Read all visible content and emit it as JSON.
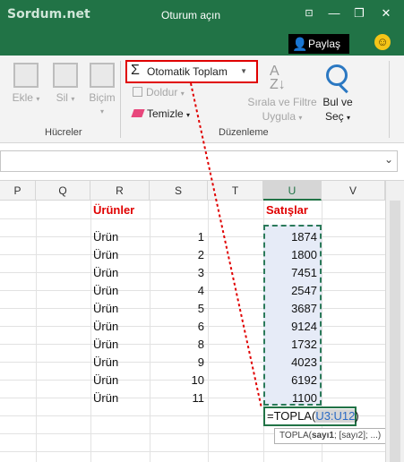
{
  "watermark": "Sordum.net",
  "window": {
    "title": "Oturum açın",
    "restore_ribbon_icon": "ribbon-display-icon",
    "minimize": "—",
    "maximize": "❐",
    "close": "✕"
  },
  "share": {
    "label": "Paylaş",
    "icon": "person-icon"
  },
  "ribbon": {
    "cells_group": {
      "label": "Hücreler",
      "insert": "Ekle",
      "delete": "Sil",
      "format": "Biçim"
    },
    "editing_group": {
      "label": "Düzenleme",
      "autosum": "Otomatik Toplam",
      "fill": "Doldur",
      "clear": "Temizle",
      "sort_filter_line1": "Sırala ve Filtre",
      "sort_filter_line2": "Uygula",
      "find_line1": "Bul ve",
      "find_line2": "Seç"
    }
  },
  "columns": [
    "P",
    "Q",
    "R",
    "S",
    "T",
    "U",
    "V"
  ],
  "selected_column": "U",
  "sheet": {
    "header_products": "Ürünler",
    "header_sales": "Satışlar",
    "rows": [
      {
        "product": "Ürün",
        "num": "1",
        "sales": "1874"
      },
      {
        "product": "Ürün",
        "num": "2",
        "sales": "1800"
      },
      {
        "product": "Ürün",
        "num": "3",
        "sales": "7451"
      },
      {
        "product": "Ürün",
        "num": "4",
        "sales": "2547"
      },
      {
        "product": "Ürün",
        "num": "5",
        "sales": "3687"
      },
      {
        "product": "Ürün",
        "num": "6",
        "sales": "9124"
      },
      {
        "product": "Ürün",
        "num": "8",
        "sales": "1732"
      },
      {
        "product": "Ürün",
        "num": "9",
        "sales": "4023"
      },
      {
        "product": "Ürün",
        "num": "10",
        "sales": "6192"
      },
      {
        "product": "Ürün",
        "num": "11",
        "sales": "1100"
      }
    ]
  },
  "formula": {
    "prefix": "=TOPLA(",
    "ref": "U3:U12",
    "suffix": ")"
  },
  "tooltip": {
    "fn": "TOPLA(",
    "arg1": "sayı1",
    "rest": "; [sayı2]; ...)"
  },
  "colors": {
    "excel_green": "#217346",
    "highlight_red": "#e00000",
    "selection_fill": "#e6ebf7"
  }
}
